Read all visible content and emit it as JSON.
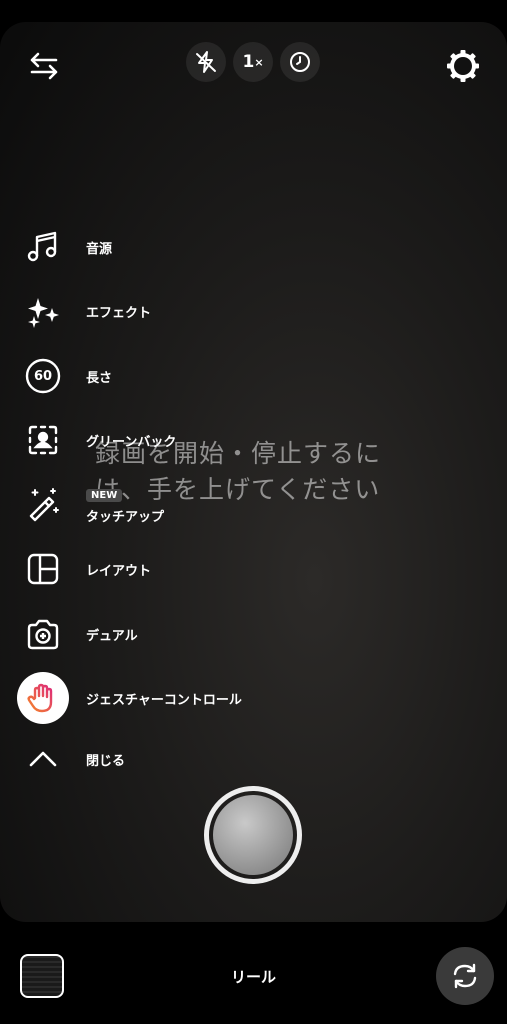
{
  "top_bar": {
    "zoom_value": "1",
    "zoom_suffix": "×"
  },
  "tools": [
    {
      "label": "音源"
    },
    {
      "label": "エフェクト"
    },
    {
      "label": "長さ",
      "badge_value": "60"
    },
    {
      "label": "グリーンバック"
    },
    {
      "label": "タッチアップ",
      "badge": "NEW"
    },
    {
      "label": "レイアウト"
    },
    {
      "label": "デュアル"
    },
    {
      "label": "ジェスチャーコントロール"
    },
    {
      "label": "閉じる"
    }
  ],
  "overlay_message": "録画を開始・停止するには、手を上げてください",
  "bottom": {
    "mode_label": "リール"
  },
  "colors": {
    "background": "#000000",
    "gesture_gradient_start": "#f58529",
    "gesture_gradient_end": "#dd2a7b"
  }
}
